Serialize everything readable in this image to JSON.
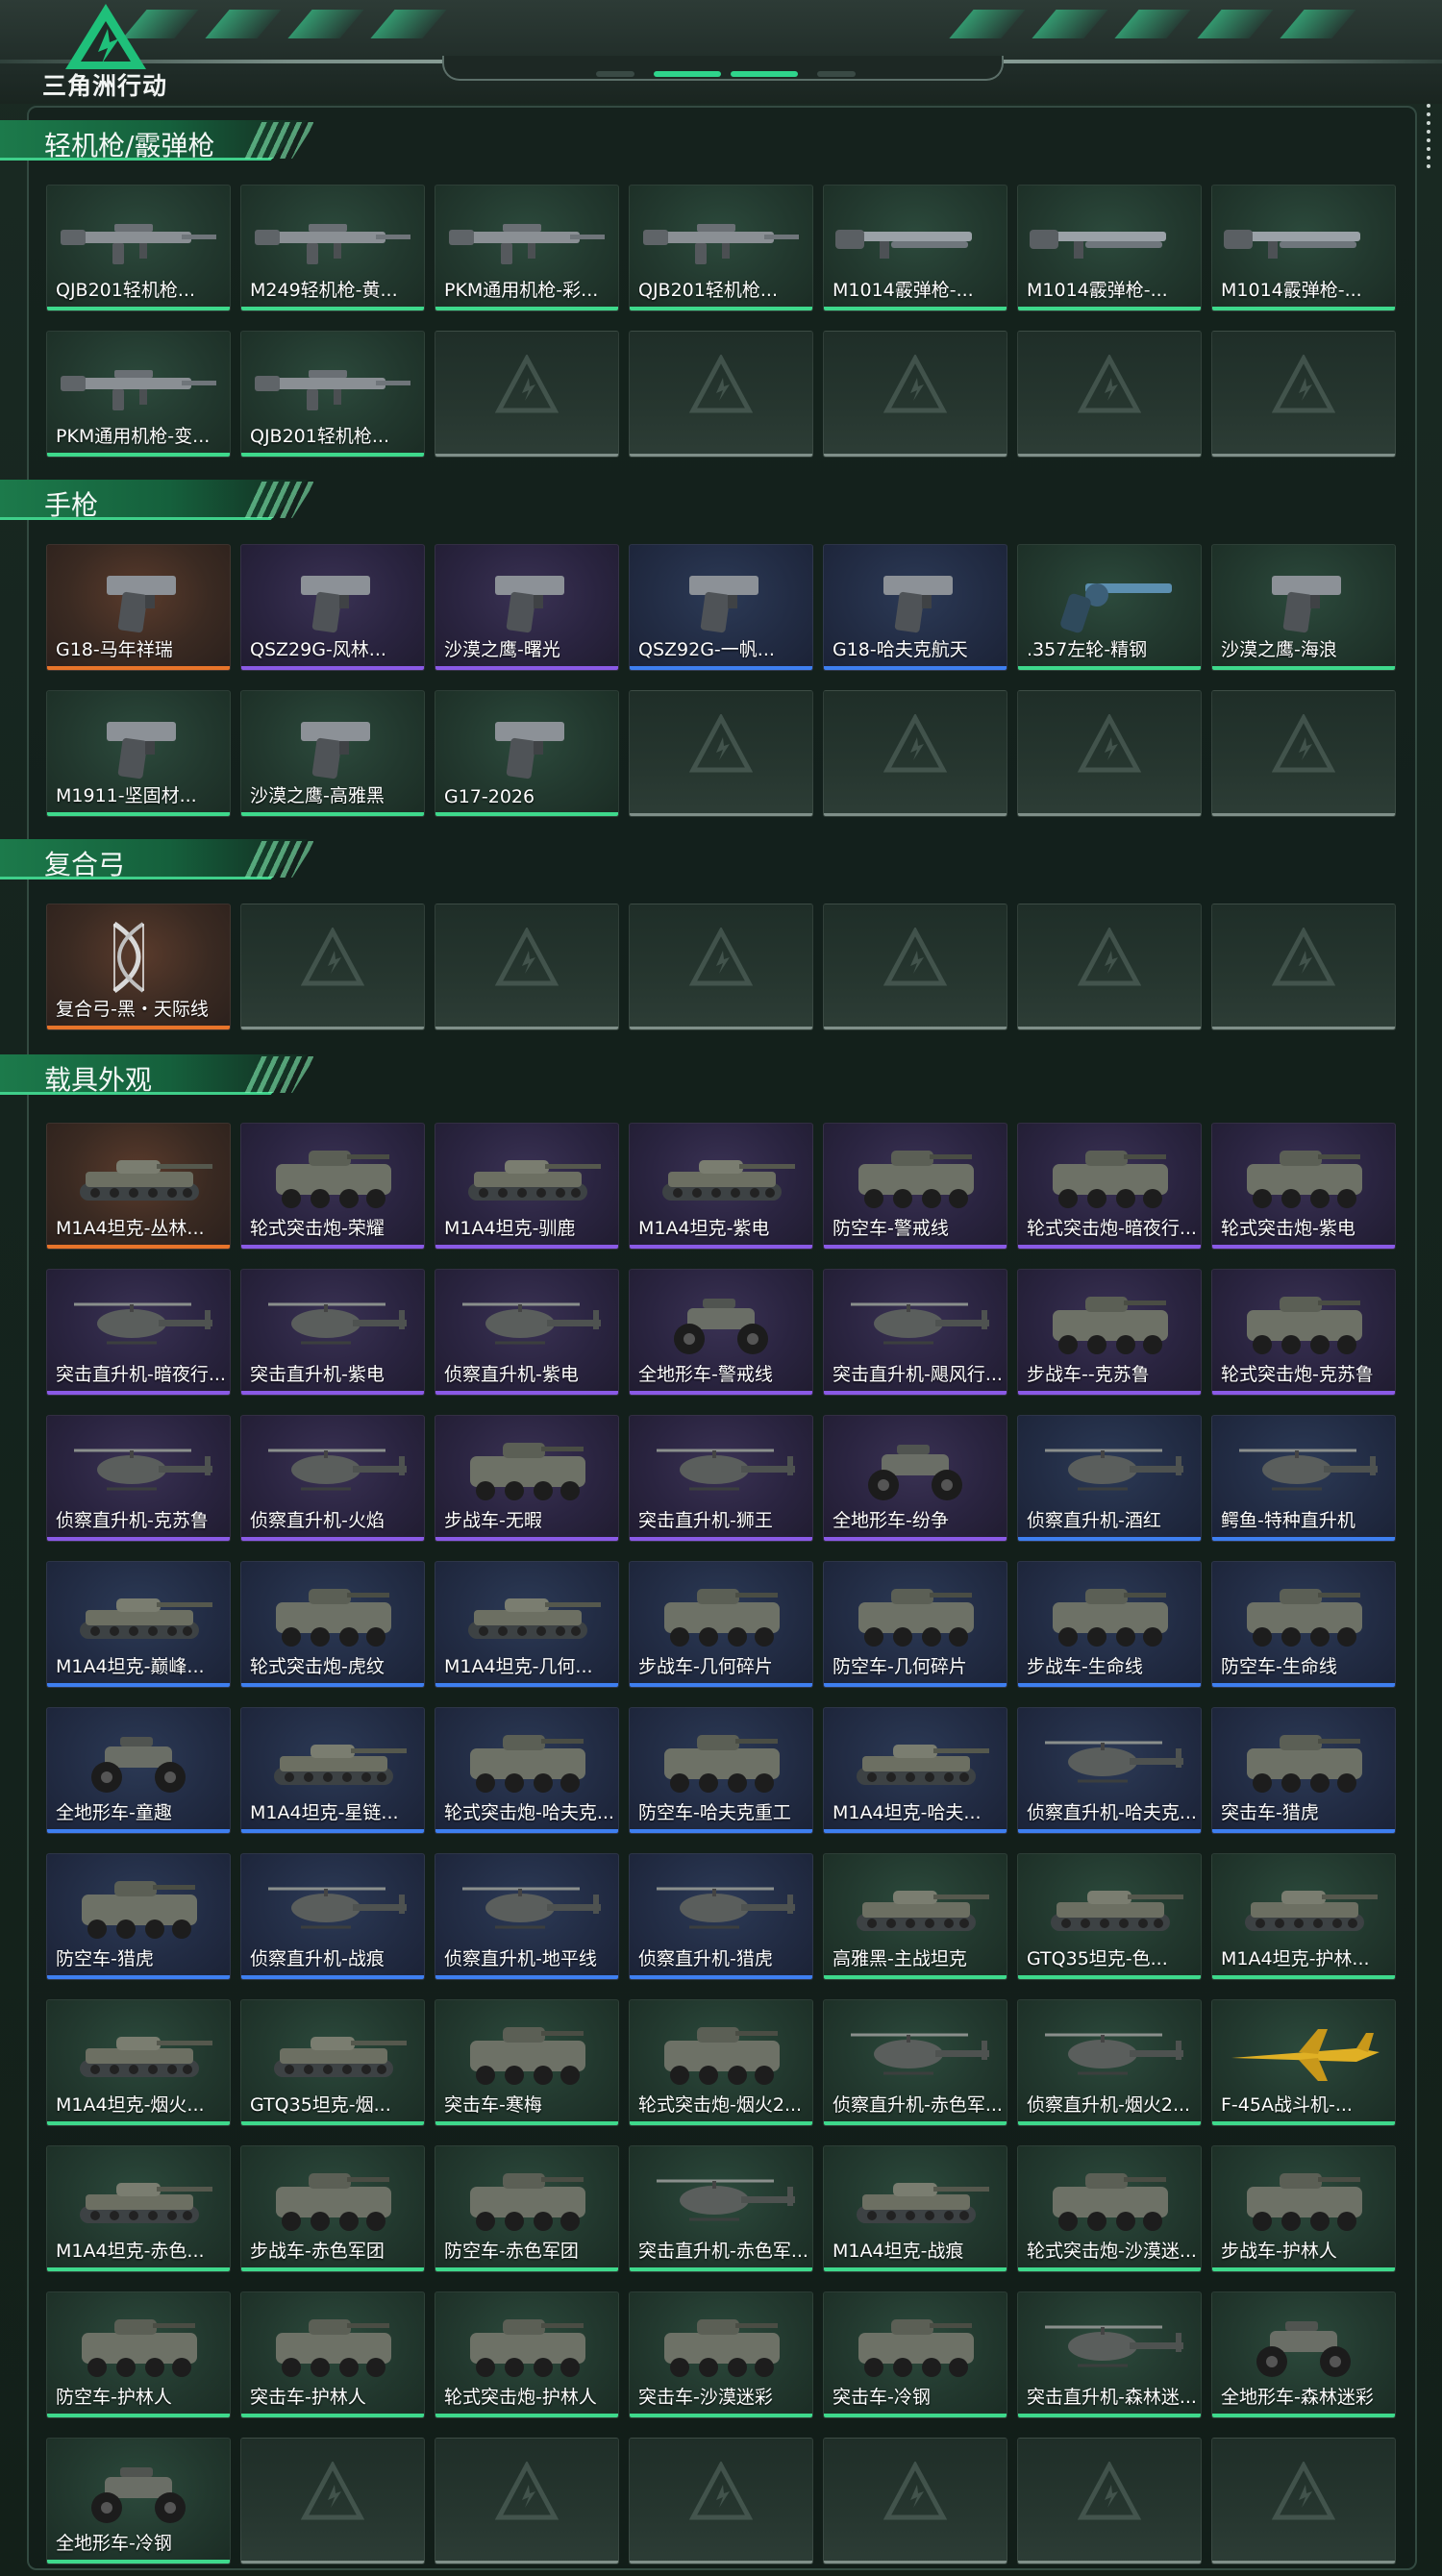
{
  "app": {
    "logo_text": "三角洲行动"
  },
  "colors": {
    "orange": "#e8742a",
    "purple": "#8a5ae6",
    "blue": "#3e7ff0",
    "green": "#3ed98c",
    "accent": "#2fbf7a"
  },
  "sections": [
    {
      "title": "轻机枪/霰弹枪",
      "items": [
        {
          "label": "QJB201轻机枪...",
          "rarity": "green",
          "icon": "machine-gun"
        },
        {
          "label": "M249轻机枪-黄...",
          "rarity": "green",
          "icon": "machine-gun"
        },
        {
          "label": "PKM通用机枪-彩...",
          "rarity": "green",
          "icon": "machine-gun"
        },
        {
          "label": "QJB201轻机枪...",
          "rarity": "green",
          "icon": "machine-gun"
        },
        {
          "label": "M1014霰弹枪-...",
          "rarity": "green",
          "icon": "shotgun"
        },
        {
          "label": "M1014霰弹枪-...",
          "rarity": "green",
          "icon": "shotgun"
        },
        {
          "label": "M1014霰弹枪-...",
          "rarity": "green",
          "icon": "shotgun"
        },
        {
          "label": "PKM通用机枪-变...",
          "rarity": "green",
          "icon": "machine-gun"
        },
        {
          "label": "QJB201轻机枪...",
          "rarity": "green",
          "icon": "machine-gun"
        }
      ],
      "empty": 5
    },
    {
      "title": "手枪",
      "items": [
        {
          "label": "G18-马年祥瑞",
          "rarity": "orange",
          "icon": "pistol"
        },
        {
          "label": "QSZ29G-风林...",
          "rarity": "purple",
          "icon": "pistol"
        },
        {
          "label": "沙漠之鹰-曙光",
          "rarity": "purple",
          "icon": "pistol"
        },
        {
          "label": "QSZ92G-一帆...",
          "rarity": "blue",
          "icon": "pistol"
        },
        {
          "label": "G18-哈夫克航天",
          "rarity": "blue",
          "icon": "pistol"
        },
        {
          "label": ".357左轮-精钢",
          "rarity": "green",
          "icon": "revolver"
        },
        {
          "label": "沙漠之鹰-海浪",
          "rarity": "green",
          "icon": "pistol"
        },
        {
          "label": "M1911-坚固材...",
          "rarity": "green",
          "icon": "pistol"
        },
        {
          "label": "沙漠之鹰-高雅黑",
          "rarity": "green",
          "icon": "pistol"
        },
        {
          "label": "G17-2026",
          "rarity": "green",
          "icon": "pistol"
        }
      ],
      "empty": 4
    },
    {
      "title": "复合弓",
      "items": [
        {
          "label": "复合弓-黑・天际线",
          "rarity": "orange",
          "icon": "bow"
        }
      ],
      "empty": 6
    },
    {
      "title": "载具外观",
      "items": [
        {
          "label": "M1A4坦克-丛林...",
          "rarity": "orange",
          "icon": "tank"
        },
        {
          "label": "轮式突击炮-荣耀",
          "rarity": "purple",
          "icon": "wheeled-vehicle"
        },
        {
          "label": "M1A4坦克-驯鹿",
          "rarity": "purple",
          "icon": "tank"
        },
        {
          "label": "M1A4坦克-紫电",
          "rarity": "purple",
          "icon": "tank"
        },
        {
          "label": "防空车-警戒线",
          "rarity": "purple",
          "icon": "wheeled-vehicle"
        },
        {
          "label": "轮式突击炮-暗夜行...",
          "rarity": "purple",
          "icon": "wheeled-vehicle"
        },
        {
          "label": "轮式突击炮-紫电",
          "rarity": "purple",
          "icon": "wheeled-vehicle"
        },
        {
          "label": "突击直升机-暗夜行...",
          "rarity": "purple",
          "icon": "helicopter"
        },
        {
          "label": "突击直升机-紫电",
          "rarity": "purple",
          "icon": "helicopter"
        },
        {
          "label": "侦察直升机-紫电",
          "rarity": "purple",
          "icon": "helicopter"
        },
        {
          "label": "全地形车-警戒线",
          "rarity": "purple",
          "icon": "atv"
        },
        {
          "label": "突击直升机-飓风行...",
          "rarity": "purple",
          "icon": "helicopter"
        },
        {
          "label": "步战车--克苏鲁",
          "rarity": "purple",
          "icon": "wheeled-vehicle"
        },
        {
          "label": "轮式突击炮-克苏鲁",
          "rarity": "purple",
          "icon": "wheeled-vehicle"
        },
        {
          "label": "侦察直升机-克苏鲁",
          "rarity": "purple",
          "icon": "helicopter"
        },
        {
          "label": "侦察直升机-火焰",
          "rarity": "purple",
          "icon": "helicopter"
        },
        {
          "label": "步战车-无暇",
          "rarity": "purple",
          "icon": "wheeled-vehicle"
        },
        {
          "label": "突击直升机-狮王",
          "rarity": "purple",
          "icon": "helicopter"
        },
        {
          "label": "全地形车-纷争",
          "rarity": "purple",
          "icon": "atv"
        },
        {
          "label": "侦察直升机-酒红",
          "rarity": "blue",
          "icon": "helicopter"
        },
        {
          "label": "鳄鱼-特种直升机",
          "rarity": "blue",
          "icon": "helicopter"
        },
        {
          "label": "M1A4坦克-巅峰...",
          "rarity": "blue",
          "icon": "tank"
        },
        {
          "label": "轮式突击炮-虎纹",
          "rarity": "blue",
          "icon": "wheeled-vehicle"
        },
        {
          "label": "M1A4坦克-几何...",
          "rarity": "blue",
          "icon": "tank"
        },
        {
          "label": "步战车-几何碎片",
          "rarity": "blue",
          "icon": "wheeled-vehicle"
        },
        {
          "label": "防空车-几何碎片",
          "rarity": "blue",
          "icon": "wheeled-vehicle"
        },
        {
          "label": "步战车-生命线",
          "rarity": "blue",
          "icon": "wheeled-vehicle"
        },
        {
          "label": "防空车-生命线",
          "rarity": "blue",
          "icon": "wheeled-vehicle"
        },
        {
          "label": "全地形车-童趣",
          "rarity": "blue",
          "icon": "atv"
        },
        {
          "label": "M1A4坦克-星链...",
          "rarity": "blue",
          "icon": "tank"
        },
        {
          "label": "轮式突击炮-哈夫克...",
          "rarity": "blue",
          "icon": "wheeled-vehicle"
        },
        {
          "label": "防空车-哈夫克重工",
          "rarity": "blue",
          "icon": "wheeled-vehicle"
        },
        {
          "label": "M1A4坦克-哈夫...",
          "rarity": "blue",
          "icon": "tank"
        },
        {
          "label": "侦察直升机-哈夫克...",
          "rarity": "blue",
          "icon": "helicopter"
        },
        {
          "label": "突击车-猎虎",
          "rarity": "blue",
          "icon": "wheeled-vehicle"
        },
        {
          "label": "防空车-猎虎",
          "rarity": "blue",
          "icon": "wheeled-vehicle"
        },
        {
          "label": "侦察直升机-战痕",
          "rarity": "blue",
          "icon": "helicopter"
        },
        {
          "label": "侦察直升机-地平线",
          "rarity": "blue",
          "icon": "helicopter"
        },
        {
          "label": "侦察直升机-猎虎",
          "rarity": "blue",
          "icon": "helicopter"
        },
        {
          "label": "高雅黑-主战坦克",
          "rarity": "green",
          "icon": "tank"
        },
        {
          "label": "GTQ35坦克-色...",
          "rarity": "green",
          "icon": "tank"
        },
        {
          "label": "M1A4坦克-护林...",
          "rarity": "green",
          "icon": "tank"
        },
        {
          "label": "M1A4坦克-烟火...",
          "rarity": "green",
          "icon": "tank"
        },
        {
          "label": "GTQ35坦克-烟...",
          "rarity": "green",
          "icon": "tank"
        },
        {
          "label": "突击车-寒梅",
          "rarity": "green",
          "icon": "wheeled-vehicle"
        },
        {
          "label": "轮式突击炮-烟火2...",
          "rarity": "green",
          "icon": "wheeled-vehicle"
        },
        {
          "label": "侦察直升机-赤色军...",
          "rarity": "green",
          "icon": "helicopter"
        },
        {
          "label": "侦察直升机-烟火2...",
          "rarity": "green",
          "icon": "helicopter"
        },
        {
          "label": "F-45A战斗机-...",
          "rarity": "green",
          "icon": "jet"
        },
        {
          "label": "M1A4坦克-赤色...",
          "rarity": "green",
          "icon": "tank"
        },
        {
          "label": "步战车-赤色军团",
          "rarity": "green",
          "icon": "wheeled-vehicle"
        },
        {
          "label": "防空车-赤色军团",
          "rarity": "green",
          "icon": "wheeled-vehicle"
        },
        {
          "label": "突击直升机-赤色军...",
          "rarity": "green",
          "icon": "helicopter"
        },
        {
          "label": "M1A4坦克-战痕",
          "rarity": "green",
          "icon": "tank"
        },
        {
          "label": "轮式突击炮-沙漠迷...",
          "rarity": "green",
          "icon": "wheeled-vehicle"
        },
        {
          "label": "步战车-护林人",
          "rarity": "green",
          "icon": "wheeled-vehicle"
        },
        {
          "label": "防空车-护林人",
          "rarity": "green",
          "icon": "wheeled-vehicle"
        },
        {
          "label": "突击车-护林人",
          "rarity": "green",
          "icon": "wheeled-vehicle"
        },
        {
          "label": "轮式突击炮-护林人",
          "rarity": "green",
          "icon": "wheeled-vehicle"
        },
        {
          "label": "突击车-沙漠迷彩",
          "rarity": "green",
          "icon": "wheeled-vehicle"
        },
        {
          "label": "突击车-冷钢",
          "rarity": "green",
          "icon": "wheeled-vehicle"
        },
        {
          "label": "突击直升机-森林迷...",
          "rarity": "green",
          "icon": "helicopter"
        },
        {
          "label": "全地形车-森林迷彩",
          "rarity": "green",
          "icon": "atv"
        },
        {
          "label": "全地形车-冷钢",
          "rarity": "green",
          "icon": "atv"
        }
      ],
      "empty": 6
    }
  ]
}
